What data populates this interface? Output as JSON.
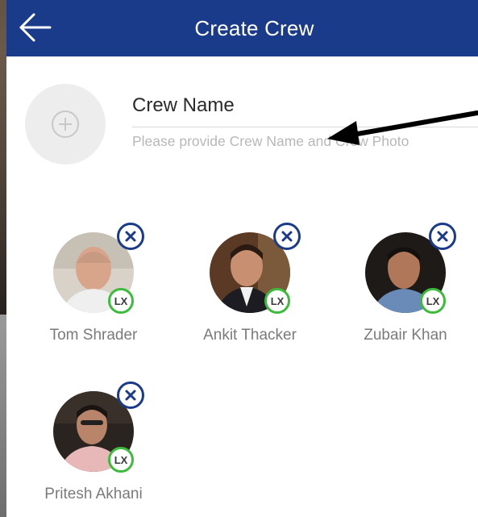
{
  "header": {
    "title": "Create Crew",
    "back_icon": "arrow-left-icon",
    "background": "#1a3a8a"
  },
  "crew_form": {
    "name_placeholder": "Crew Name",
    "name_value": "",
    "hint": "Please provide Crew Name and Crew Photo",
    "photo_icon": "plus-circle-icon"
  },
  "members": [
    {
      "name": "Tom Shrader",
      "badge": "LX"
    },
    {
      "name": "Ankit Thacker",
      "badge": "LX"
    },
    {
      "name": "Zubair Khan",
      "badge": "LX"
    },
    {
      "name": "Pritesh Akhani",
      "badge": "LX"
    }
  ],
  "colors": {
    "accent": "#1a3a8a",
    "badge_ring": "#3dbb3d",
    "hint_text": "#b8b8b8",
    "name_text": "#7a7a7a"
  }
}
